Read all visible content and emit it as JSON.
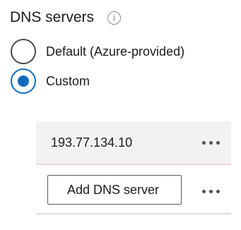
{
  "section": {
    "title": "DNS servers",
    "info_icon": "info-icon",
    "info_glyph": "i"
  },
  "options": [
    {
      "label": "Default (Azure-provided)",
      "selected": false
    },
    {
      "label": "Custom",
      "selected": true
    }
  ],
  "dns_servers": [
    {
      "value": "193.77.134.10"
    }
  ],
  "add_field": {
    "placeholder": "Add DNS server"
  },
  "colors": {
    "accent": "#0f6cbd",
    "row_background": "#f2f2f2"
  }
}
